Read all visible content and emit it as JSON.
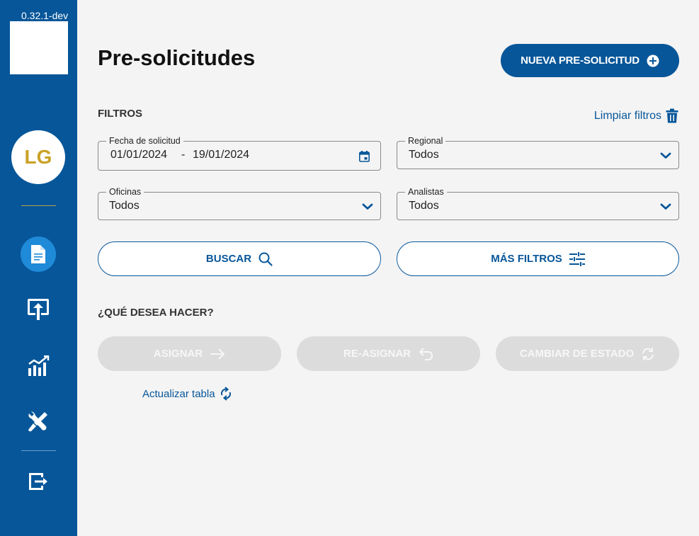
{
  "app": {
    "version": "0.32.1-dev",
    "user_initials": "LG"
  },
  "sidebar": {
    "items": [
      {
        "name": "document-icon",
        "active": true
      },
      {
        "name": "upload-icon",
        "active": false
      },
      {
        "name": "chart-icon",
        "active": false
      },
      {
        "name": "tools-icon",
        "active": false
      },
      {
        "name": "logout-icon",
        "active": false
      }
    ]
  },
  "header": {
    "title": "Pre-solicitudes",
    "new_button_label": "NUEVA PRE-SOLICITUD"
  },
  "filters": {
    "section_label": "FILTROS",
    "clear_label": "Limpiar filtros",
    "date": {
      "label": "Fecha de solicitud",
      "from": "01/01/2024",
      "separator": "-",
      "to": "19/01/2024"
    },
    "regional": {
      "label": "Regional",
      "value": "Todos"
    },
    "oficinas": {
      "label": "Oficinas",
      "value": "Todos"
    },
    "analistas": {
      "label": "Analistas",
      "value": "Todos"
    },
    "search_label": "BUSCAR",
    "more_filters_label": "MÁS FILTROS"
  },
  "actions": {
    "section_label": "¿QUÉ DESEA HACER?",
    "assign_label": "ASIGNAR",
    "reassign_label": "RE-ASIGNAR",
    "change_status_label": "CAMBIAR DE ESTADO",
    "refresh_label": "Actualizar tabla"
  },
  "colors": {
    "primary": "#075699",
    "sidebar_active": "#1f8ad8",
    "avatar_text": "#c9a227",
    "disabled_bg": "#dcdcdc",
    "background": "#f4f4f4"
  }
}
